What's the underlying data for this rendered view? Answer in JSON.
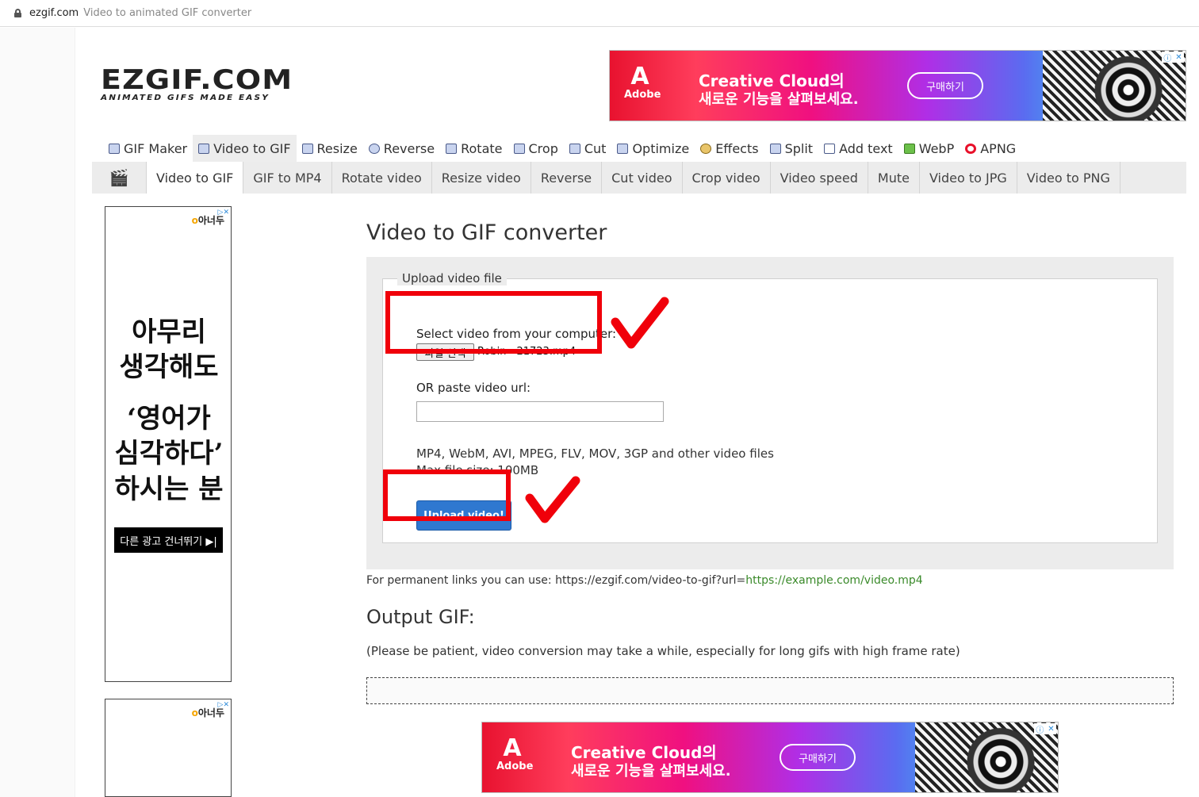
{
  "browser": {
    "domain": "ezgif.com",
    "page_title": "Video to animated GIF converter"
  },
  "logo": {
    "main": "EZGIF.COM",
    "tagline": "ANIMATED GIFS MADE EASY"
  },
  "ad_top": {
    "brand": "Adobe",
    "headline1": "Creative Cloud의",
    "headline2": "새로운 기능을 살펴보세요.",
    "button": "구매하기"
  },
  "ad_bottom": {
    "brand": "Adobe",
    "headline1": "Creative Cloud의",
    "headline2": "새로운 기능을 살펴보세요.",
    "button": "구매하기"
  },
  "main_nav": [
    {
      "label": "GIF Maker",
      "icon": "gif-maker-icon",
      "active": false
    },
    {
      "label": "Video to GIF",
      "icon": "video-icon",
      "active": true
    },
    {
      "label": "Resize",
      "icon": "resize-icon",
      "active": false
    },
    {
      "label": "Reverse",
      "icon": "reverse-icon",
      "active": false
    },
    {
      "label": "Rotate",
      "icon": "rotate-icon",
      "active": false
    },
    {
      "label": "Crop",
      "icon": "crop-icon",
      "active": false
    },
    {
      "label": "Cut",
      "icon": "cut-icon",
      "active": false
    },
    {
      "label": "Optimize",
      "icon": "optimize-icon",
      "active": false
    },
    {
      "label": "Effects",
      "icon": "effects-icon",
      "active": false
    },
    {
      "label": "Split",
      "icon": "split-icon",
      "active": false
    },
    {
      "label": "Add text",
      "icon": "add-text-icon",
      "active": false
    },
    {
      "label": "WebP",
      "icon": "webp-icon",
      "active": false
    },
    {
      "label": "APNG",
      "icon": "apng-icon",
      "active": false
    }
  ],
  "sub_nav": [
    {
      "label": "Video to GIF",
      "active": true
    },
    {
      "label": "GIF to MP4",
      "active": false
    },
    {
      "label": "Rotate video",
      "active": false
    },
    {
      "label": "Resize video",
      "active": false
    },
    {
      "label": "Reverse",
      "active": false
    },
    {
      "label": "Cut video",
      "active": false
    },
    {
      "label": "Crop video",
      "active": false
    },
    {
      "label": "Video speed",
      "active": false
    },
    {
      "label": "Mute",
      "active": false
    },
    {
      "label": "Video to JPG",
      "active": false
    },
    {
      "label": "Video to PNG",
      "active": false
    }
  ],
  "side_ad": {
    "brand": "아너두",
    "lines": [
      "아무리",
      "생각해도",
      "‘영어가",
      "심각하다’",
      "하시는 분"
    ],
    "skip": "다른 광고 건너뛰기 ▶|"
  },
  "side_ad2": {
    "brand": "아너두"
  },
  "main": {
    "title": "Video to GIF converter",
    "fieldset_legend": "Upload video file",
    "select_label": "Select video from your computer:",
    "file_button": "파일 선택",
    "file_name": "Robin - 21723.mp4",
    "url_label": "OR paste video url:",
    "url_value": "",
    "formats": "MP4, WebM, AVI, MPEG, FLV, MOV, 3GP and other video files",
    "max_size": "Max file size: 100MB",
    "upload_button": "Upload video!",
    "permalink_prefix": "For permanent links you can use: https://ezgif.com/video-to-gif?url=",
    "permalink_example": "https://example.com/video.mp4",
    "output_title": "Output GIF:",
    "patience_note": "(Please be patient, video conversion may take a while, especially for long gifs with high frame rate)"
  },
  "colors": {
    "highlight_red": "#f0000a",
    "upload_blue": "#2f78d0",
    "link_green": "#3a8a2a"
  }
}
